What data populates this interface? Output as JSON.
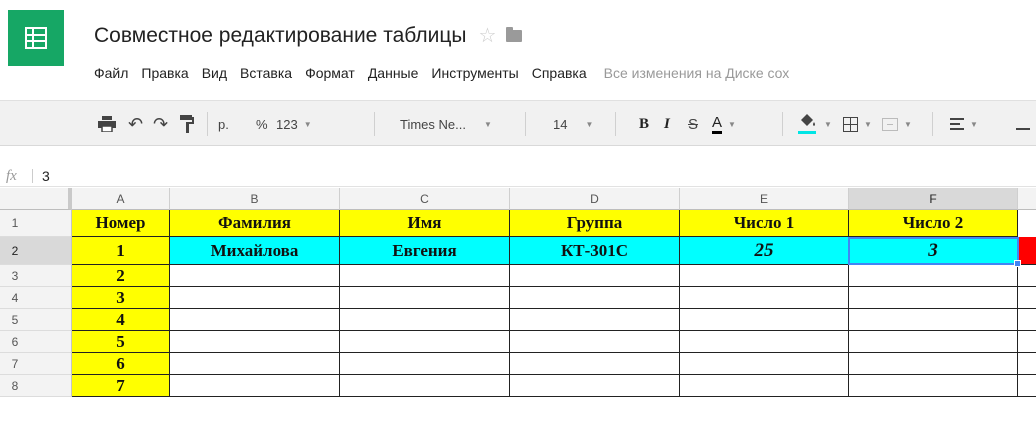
{
  "app": {
    "title": "Совместное редактирование таблицы",
    "star_icon": "star-outline-icon",
    "folder_icon": "folder-icon"
  },
  "menu": {
    "items": [
      "Файл",
      "Правка",
      "Вид",
      "Вставка",
      "Формат",
      "Данные",
      "Инструменты",
      "Справка"
    ],
    "save_status": "Все изменения на Диске сох"
  },
  "toolbar": {
    "print": "print-icon",
    "undo": "undo-icon",
    "redo": "redo-icon",
    "paint_format": "paint-format-icon",
    "currency": "р.",
    "percent": "%",
    "number_format": "123",
    "font": "Times Ne...",
    "font_size": "14",
    "bold": "B",
    "italic": "I",
    "strikethrough": "S",
    "text_color": "A",
    "fill_color_swatch": "#00e5e5"
  },
  "formula_bar": {
    "icon": "fx",
    "value": "3"
  },
  "sheet": {
    "columns": [
      "A",
      "B",
      "C",
      "D",
      "E",
      "F"
    ],
    "rows": [
      "1",
      "2",
      "3",
      "4",
      "5",
      "6",
      "7",
      "8"
    ],
    "selected_column": "F",
    "selected_row": "2",
    "header": [
      "Номер",
      "Фамилия",
      "Имя",
      "Группа",
      "Число 1",
      "Число 2"
    ],
    "data_row": [
      "1",
      "Михайлова",
      "Евгения",
      "КТ-301С",
      "25",
      "3"
    ],
    "numbers": [
      "2",
      "3",
      "4",
      "5",
      "6",
      "7"
    ],
    "colors": {
      "yellow": "#ffff00",
      "cyan": "#00ffff",
      "red": "#ff0000"
    }
  }
}
